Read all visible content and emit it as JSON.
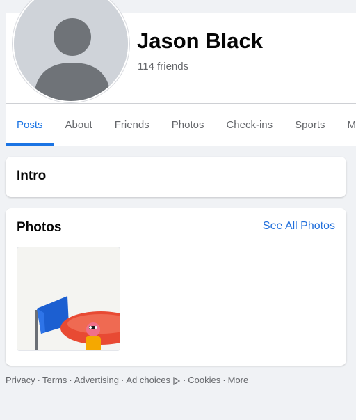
{
  "profile": {
    "name": "Jason Black",
    "friends": "114 friends"
  },
  "tabs": [
    {
      "label": "Posts",
      "active": true
    },
    {
      "label": "About"
    },
    {
      "label": "Friends"
    },
    {
      "label": "Photos"
    },
    {
      "label": "Check-ins"
    },
    {
      "label": "Sports"
    },
    {
      "label": "M"
    }
  ],
  "intro": {
    "title": "Intro"
  },
  "photos": {
    "title": "Photos",
    "see_all": "See All Photos",
    "items": [
      {
        "description_icon": "toy-flag-photo"
      }
    ]
  },
  "footer": {
    "links": [
      "Privacy",
      "Terms",
      "Advertising",
      "Ad choices",
      "Cookies",
      "More"
    ],
    "separator": "·"
  },
  "colors": {
    "accent": "#1b74e4",
    "link": "#216fdb",
    "background": "#f0f2f5",
    "muted_text": "#65676b"
  }
}
